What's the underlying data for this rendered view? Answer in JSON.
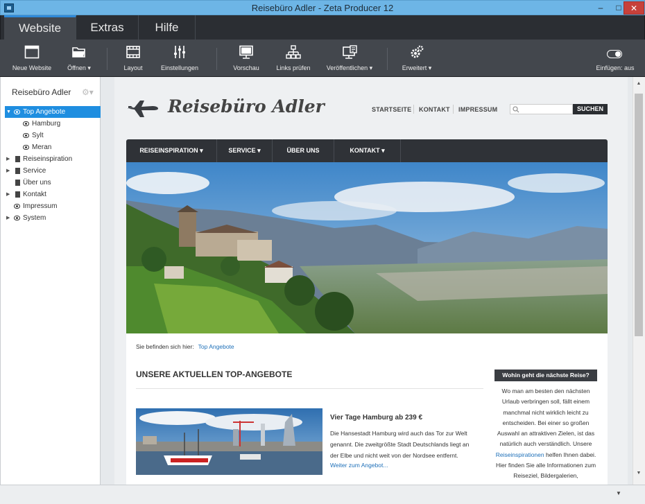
{
  "window": {
    "title": "Reisebüro Adler - Zeta Producer 12",
    "min": "–",
    "max": "□",
    "close": "✕"
  },
  "ribbon_tabs": [
    {
      "label": "Website",
      "active": true
    },
    {
      "label": "Extras"
    },
    {
      "label": "Hilfe"
    }
  ],
  "toolbar": {
    "items": [
      "Neue Website",
      "Öffnen ▾",
      "Layout",
      "Einstellungen",
      "Vorschau",
      "Links prüfen",
      "Veröffentlichen ▾",
      "Erweitert ▾"
    ],
    "insert_toggle": "Einfügen: aus"
  },
  "sidebar": {
    "title": "Reisebüro Adler",
    "gear": "⚙▾",
    "tree": [
      {
        "label": "Top Angebote",
        "icon": "eye-icon",
        "expanded": true,
        "selected": true
      },
      {
        "label": "Hamburg",
        "icon": "eye-icon",
        "child": true
      },
      {
        "label": "Sylt",
        "icon": "eye-icon",
        "child": true
      },
      {
        "label": "Meran",
        "icon": "eye-icon",
        "child": true
      },
      {
        "label": "Reiseinspiration",
        "icon": "page-icon",
        "collapsed": true
      },
      {
        "label": "Service",
        "icon": "page-icon",
        "collapsed": true
      },
      {
        "label": "Über uns",
        "icon": "page-icon"
      },
      {
        "label": "Kontakt",
        "icon": "page-icon",
        "collapsed": true
      },
      {
        "label": "Impressum",
        "icon": "eye-icon"
      },
      {
        "label": "System",
        "icon": "eye-icon",
        "collapsed": true
      }
    ]
  },
  "site": {
    "logo": "Reisebüro Adler",
    "topnav": [
      "STARTSEITE",
      "KONTAKT",
      "IMPRESSUM"
    ],
    "search_button": "SUCHEN",
    "mainnav": [
      {
        "label": "REISEINSPIRATION ▾"
      },
      {
        "label": "SERVICE ▾"
      },
      {
        "label": "ÜBER UNS"
      },
      {
        "label": "KONTAKT ▾"
      }
    ],
    "breadcrumb": {
      "prefix": "Sie befinden sich hier:",
      "link": "Top Angebote"
    },
    "heading": "UNSERE AKTUELLEN TOP-ANGEBOTE",
    "article": {
      "title": "Vier Tage Hamburg ab 239 €",
      "text": "Die Hansestadt Hamburg wird auch das Tor zur Welt genannt. Die zweitgrößte Stadt Deutschlands liegt an der Elbe und nicht weit von der Nordsee entfernt.",
      "link": "Weiter zum Angebot..."
    },
    "aside": {
      "heading": "Wohin geht die nächste Reise?",
      "text_before": "Wo man am besten den nächsten Urlaub verbringen soll, fällt einem manchmal nicht wirklich leicht zu entscheiden. Bei einer so großen Auswahl an attraktiven Zielen, ist das natürlich auch verständlich. Unsere",
      "link": "Reiseinspirationen",
      "text_after": "helfen Ihnen dabei. Hier finden Sie alle Informationen zum Reiseziel, Bildergalerien, Erfahrungsberichte"
    }
  },
  "colors": {
    "accent": "#1f8ee0",
    "titlebar": "#6db5e6",
    "toolbar": "#43474d",
    "link": "#1d6fb8"
  }
}
